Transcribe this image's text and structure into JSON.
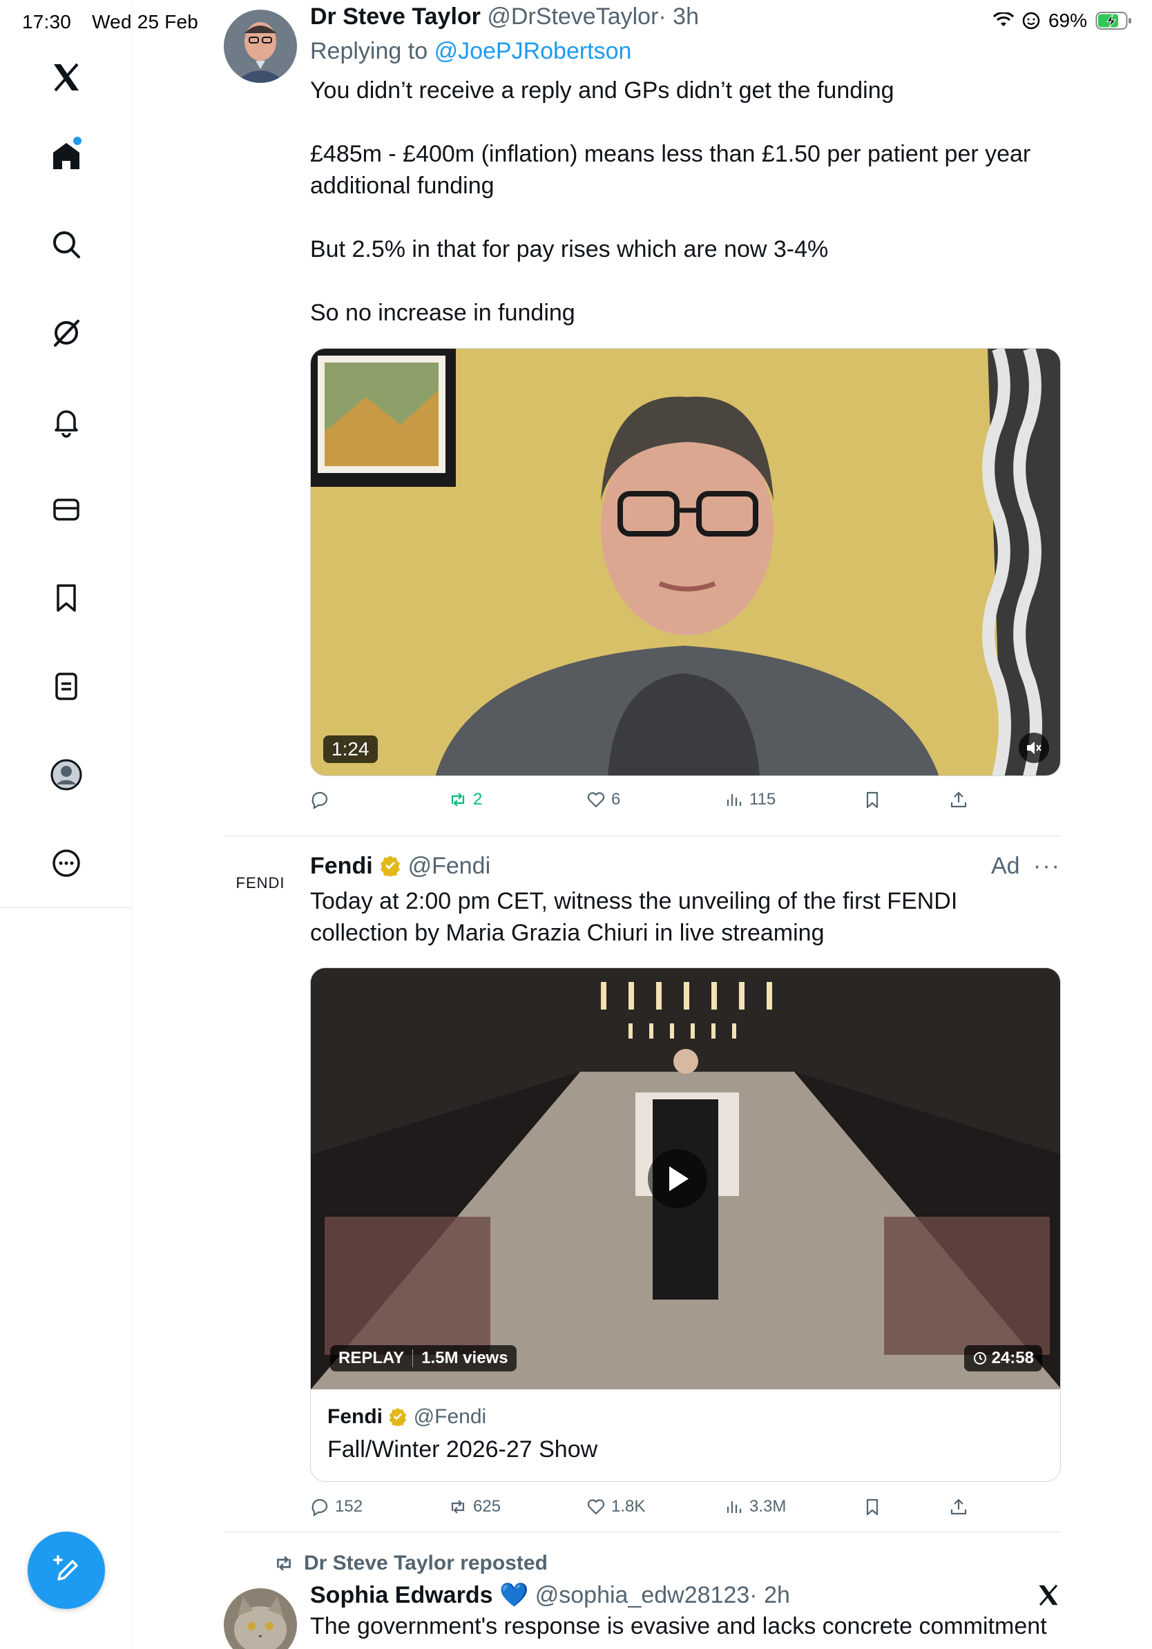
{
  "status_bar": {
    "time": "17:30",
    "date": "Wed 25 Feb",
    "battery": "69%"
  },
  "sidebar": {
    "items": [
      {
        "icon": "x-logo-icon"
      },
      {
        "icon": "home-icon"
      },
      {
        "icon": "search-icon"
      },
      {
        "icon": "grok-icon"
      },
      {
        "icon": "bell-icon"
      },
      {
        "icon": "mail-icon"
      },
      {
        "icon": "bookmark-icon"
      },
      {
        "icon": "lists-icon"
      },
      {
        "icon": "profile-icon"
      },
      {
        "icon": "more-icon"
      }
    ],
    "compose_icon": "compose-icon"
  },
  "tweets": [
    {
      "author": "Dr Steve Taylor",
      "handle": "@DrSteveTaylor",
      "time": "· 3h",
      "replying_prefix": "Replying to",
      "replying_to": "@JoePJRobertson",
      "paragraphs": [
        "You didn’t receive a reply and GPs didn’t get the funding",
        "£485m - £400m (inflation) means less than £1.50 per patient per year additional funding",
        "But 2.5% in that for pay rises which are now 3-4%",
        "So no increase in funding"
      ],
      "video_duration": "1:24",
      "replies": "",
      "reposts": "2",
      "likes": "6",
      "views": "115"
    },
    {
      "author": "Fendi",
      "handle": "@Fendi",
      "ad_label": "Ad",
      "avatar_text": "FENDI",
      "text": "Today at 2:00 pm CET, witness the unveiling of the first FENDI collection by Maria Grazia Chiuri in live streaming",
      "replay_label": "REPLAY",
      "replay_views": "1.5M views",
      "video_duration": "24:58",
      "card_author": "Fendi",
      "card_handle": "@Fendi",
      "card_title": "Fall/Winter 2026-27 Show",
      "replies": "152",
      "reposts": "625",
      "likes": "1.8K",
      "views": "3.3M"
    },
    {
      "repost_label": "Dr Steve Taylor reposted",
      "author": "Sophia Edwards",
      "author_emoji": "💙",
      "handle": "@sophia_edw28123",
      "time": "· 2h",
      "text": "The government's response is evasive and lacks concrete commitment"
    }
  ]
}
